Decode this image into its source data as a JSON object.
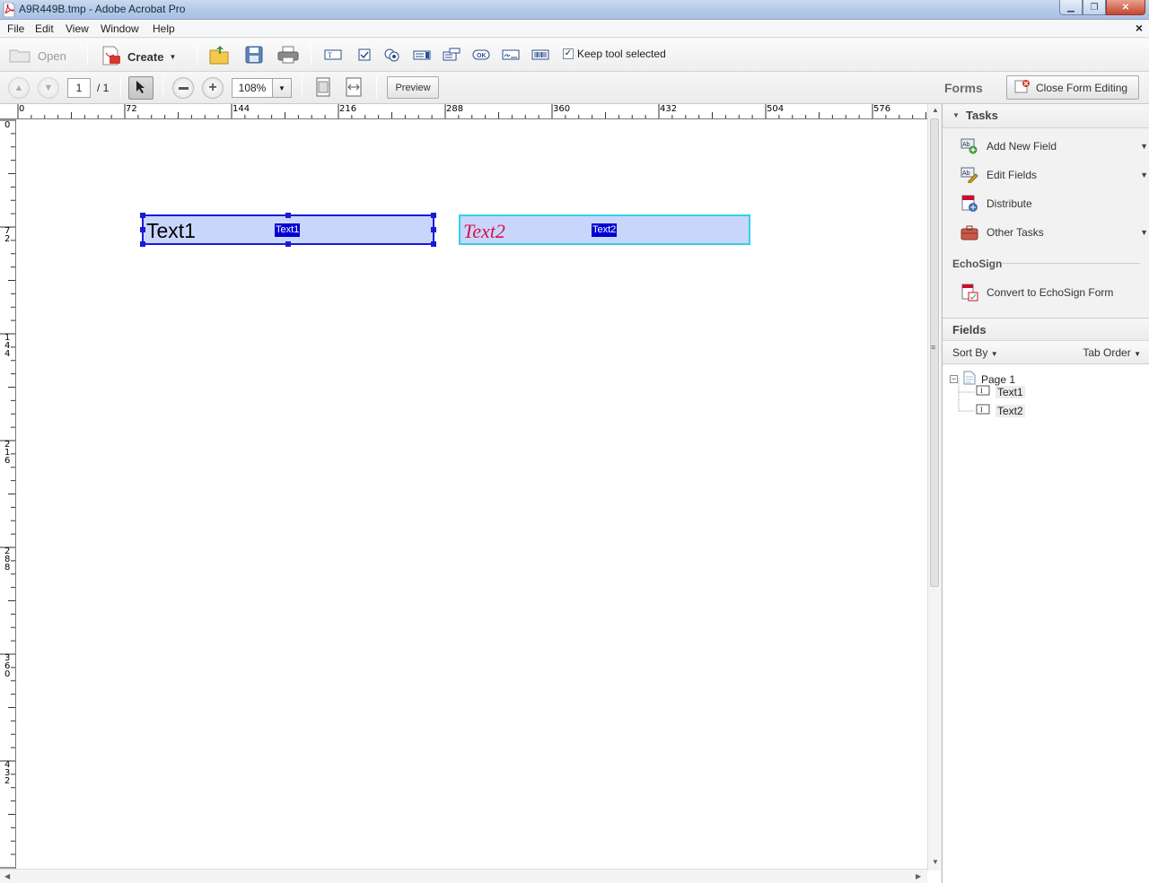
{
  "window": {
    "title": "A9R449B.tmp - Adobe Acrobat Pro",
    "min_icon": "minimize-icon",
    "max_icon": "maximize-icon",
    "close_icon": "close-icon"
  },
  "menu": {
    "items": [
      "File",
      "Edit",
      "View",
      "Window",
      "Help"
    ],
    "close_glyph": "×"
  },
  "toolbar": {
    "open_label": "Open",
    "create_label": "Create",
    "keep_tool_label": "Keep tool selected",
    "keep_tool_checked": true,
    "check_glyph": "✓"
  },
  "nav": {
    "page_current": "1",
    "page_total": "/ 1",
    "zoom": "108%",
    "preview_label": "Preview",
    "forms_label": "Forms",
    "close_form_editing_label": "Close Form Editing"
  },
  "ruler": {
    "top_labels": [
      "0",
      "72",
      "144",
      "216",
      "288",
      "360",
      "432",
      "504",
      "576"
    ],
    "left_labels": [
      "0",
      "7\n2",
      "1\n4\n4",
      "2\n1\n6",
      "2\n8\n8",
      "3\n6\n0",
      "4\n3\n2"
    ]
  },
  "document": {
    "fields": [
      {
        "value": "Text1",
        "name": "Text1",
        "selected": true
      },
      {
        "value": "Text2",
        "name": "Text2",
        "selected": false
      }
    ]
  },
  "panel": {
    "tasks_title": "Tasks",
    "tasks": [
      {
        "label": "Add New Field",
        "has_menu": true,
        "icon": "add-field-icon"
      },
      {
        "label": "Edit Fields",
        "has_menu": true,
        "icon": "edit-fields-icon"
      },
      {
        "label": "Distribute",
        "has_menu": false,
        "icon": "distribute-icon"
      },
      {
        "label": "Other Tasks",
        "has_menu": true,
        "icon": "briefcase-icon"
      }
    ],
    "echosign_title": "EchoSign",
    "echosign_task": "Convert to EchoSign Form",
    "fields_title": "Fields",
    "sort_by_label": "Sort By",
    "tab_order_label": "Tab Order",
    "tree": {
      "page_label": "Page 1",
      "children": [
        "Text1",
        "Text2"
      ]
    }
  },
  "colors": {
    "field_fill": "#c9d6fb",
    "selected_border": "#1a1ad6",
    "unselected_border": "#2fd0ea",
    "text2_color": "#d4144b",
    "name_tag_bg": "#0000d2"
  }
}
